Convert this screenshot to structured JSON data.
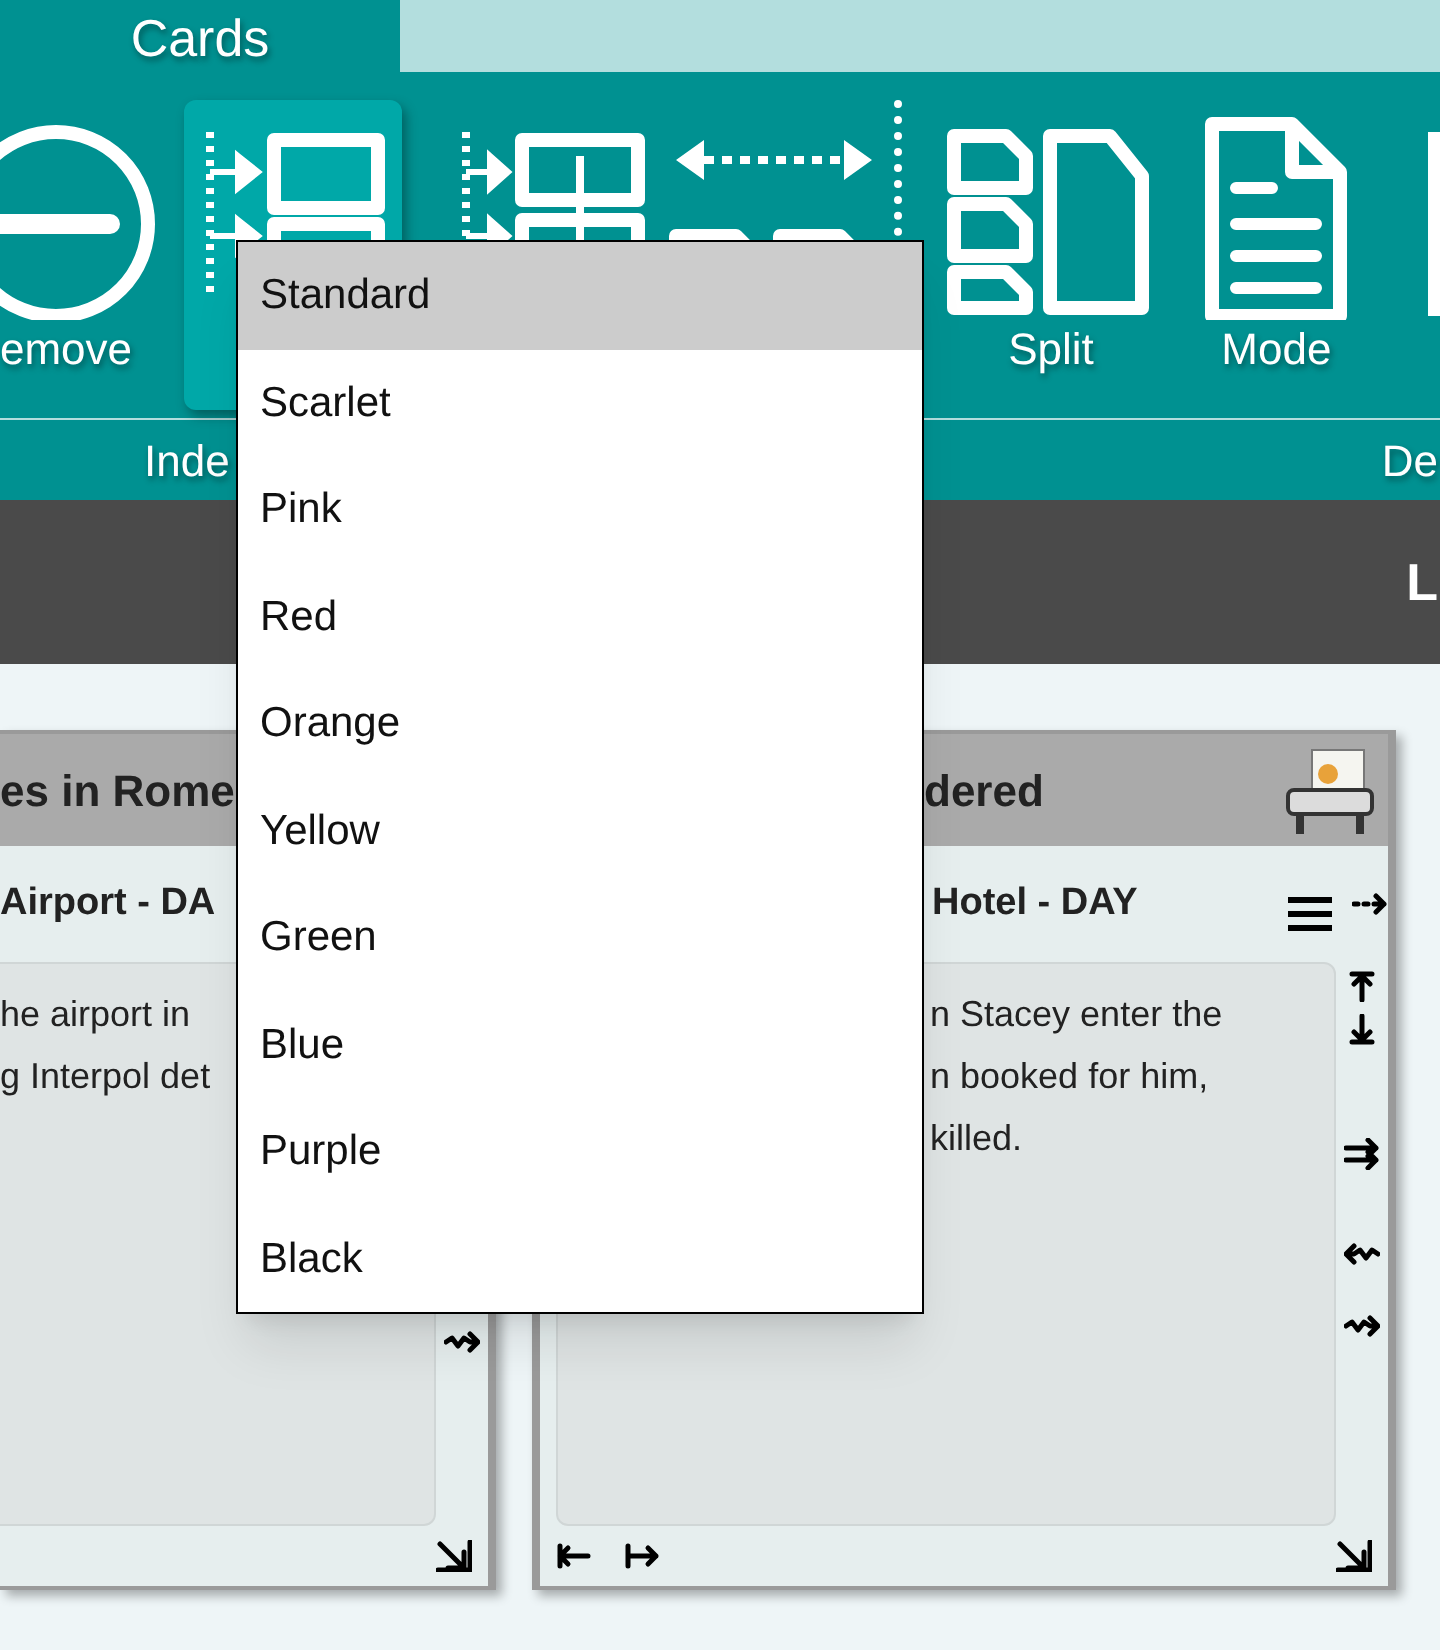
{
  "tabs": [
    {
      "label": "Cards",
      "selected": true
    }
  ],
  "ribbon": {
    "buttons": [
      {
        "kind": "remove",
        "label": "emove",
        "selected": false
      },
      {
        "kind": "index",
        "selected": true
      },
      {
        "kind": "insert",
        "selected": false
      },
      {
        "kind": "spread",
        "selected": false
      },
      {
        "kind": "split",
        "label": "Split",
        "selected": false
      },
      {
        "kind": "mode",
        "label": "Mode",
        "selected": false
      },
      {
        "kind": "partial",
        "selected": false
      }
    ],
    "groups": [
      "Inde",
      "De"
    ]
  },
  "header_bar": {
    "label": "L"
  },
  "cards": [
    {
      "title": "es in Rome",
      "scene": "Airport - DA",
      "body": [
        "he airport in",
        "g Interpol det"
      ],
      "clipped": true
    },
    {
      "title": "dered",
      "scene": "Hotel - DAY",
      "body": [
        "n Stacey enter the",
        "n booked for him,",
        "killed."
      ],
      "clipped": false
    }
  ],
  "menu": {
    "items": [
      {
        "label": "Standard",
        "selected": true
      },
      {
        "label": "Scarlet",
        "selected": false
      },
      {
        "label": "Pink",
        "selected": false
      },
      {
        "label": "Red",
        "selected": false
      },
      {
        "label": "Orange",
        "selected": false
      },
      {
        "label": "Yellow",
        "selected": false
      },
      {
        "label": "Green",
        "selected": false
      },
      {
        "label": "Blue",
        "selected": false
      },
      {
        "label": "Purple",
        "selected": false
      },
      {
        "label": "Black",
        "selected": false
      }
    ]
  }
}
